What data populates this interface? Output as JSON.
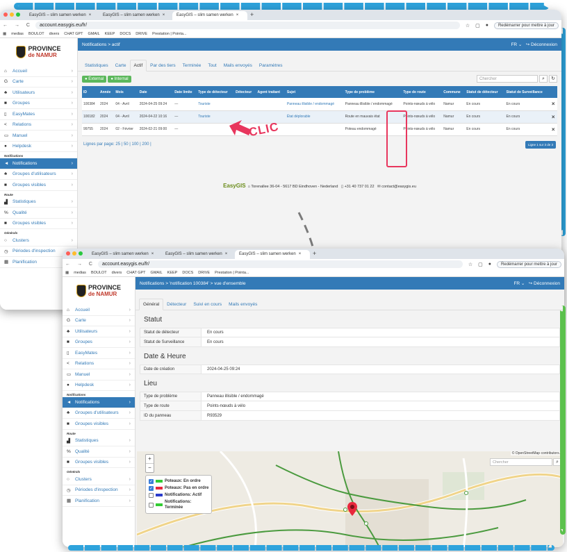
{
  "browser": {
    "tabs": [
      "EasyGIS – slim samen werken",
      "EasyGIS – slim samen werken",
      "EasyGIS – slim samen werken"
    ],
    "url": "account.easygis.eu/fr/",
    "update_label": "Redémarrer pour mettre à jour",
    "bookmarks": [
      "medias",
      "BOULOT",
      "divers",
      "CHAT GPT",
      "GMAIL",
      "KEEP",
      "DOCS",
      "DRIVE",
      "Prestation | Pointa..."
    ]
  },
  "sidebar": {
    "logo_line1": "PROVINCE",
    "logo_line2": "de NAMUR",
    "items_top": [
      {
        "label": "Accueil",
        "icon": "home-icon"
      },
      {
        "label": "Carte",
        "icon": "map-icon"
      },
      {
        "label": "Utilisateurs",
        "icon": "users-icon"
      },
      {
        "label": "Groupes",
        "icon": "folder-icon"
      },
      {
        "label": "EasyMates",
        "icon": "phone-icon"
      },
      {
        "label": "Relations",
        "icon": "share-icon"
      },
      {
        "label": "Manuel",
        "icon": "book-icon"
      },
      {
        "label": "Helpdesk",
        "icon": "question-icon"
      }
    ],
    "section_notifications": "Notifications",
    "items_notifications": [
      {
        "label": "Notifications",
        "icon": "bullhorn-icon"
      },
      {
        "label": "Groupes d'utilisateurs",
        "icon": "users-icon"
      },
      {
        "label": "Groupes visibles",
        "icon": "folder-icon"
      }
    ],
    "section_route": "Route",
    "items_route": [
      {
        "label": "Statistiques",
        "icon": "bar-chart-icon"
      },
      {
        "label": "Qualité",
        "icon": "percent-icon"
      },
      {
        "label": "Groupes visibles",
        "icon": "folder-icon"
      }
    ],
    "section_generic": "Générals",
    "items_generic": [
      {
        "label": "Clusters",
        "icon": "circle-icon"
      },
      {
        "label": "Périodes d'inspection",
        "icon": "clock-icon"
      },
      {
        "label": "Planification",
        "icon": "calendar-icon"
      }
    ]
  },
  "window1": {
    "breadcrumb": "Notifications > actif",
    "lang": "FR",
    "logout": "Déconnexion",
    "tabs": [
      "Statistiques",
      "Carte",
      "Actif",
      "Par des tiers",
      "Terminée",
      "Tout",
      "Mails envoyés",
      "Paramètres"
    ],
    "btn_external": "External",
    "btn_internal": "Internal",
    "search_placeholder": "Chercher",
    "columns": [
      "ID",
      "Année",
      "Mois",
      "Date",
      "Date limite",
      "Type de détecteur",
      "Détecteur",
      "Agent traitant",
      "Sujet",
      "Type de problème",
      "Type de route",
      "Commune",
      "Statut de détecteur",
      "Statut de Surveillance"
    ],
    "rows": [
      {
        "id": "100384",
        "year": "2024",
        "month": "04 - Avril",
        "date": "2024-04-25 09:24",
        "deadline": "—",
        "dtype": "Touriste",
        "detector": "",
        "agent": "",
        "subject": "Panneau illisible / endommagé",
        "ptype": "Panneau illisible / endommagé",
        "rtype": "Points-nœuds à vélo",
        "commune": "Namur",
        "dstatus": "En cours",
        "sstatus": "En cours"
      },
      {
        "id": "100182",
        "year": "2024",
        "month": "04 - Avril",
        "date": "2024-04-22 10:16",
        "deadline": "—",
        "dtype": "Touriste",
        "detector": "",
        "agent": "",
        "subject": "État déplorable",
        "ptype": "Route en mauvais état",
        "rtype": "Points-nœuds à vélo",
        "commune": "Namur",
        "dstatus": "En cours",
        "sstatus": "En cours"
      },
      {
        "id": "99755",
        "year": "2024",
        "month": "02 - Février",
        "date": "2024-02-21 09:00",
        "deadline": "—",
        "dtype": "",
        "detector": "",
        "agent": "",
        "subject": "",
        "ptype": "Poteau endommagé",
        "rtype": "Points-nœuds à vélo",
        "commune": "Namur",
        "dstatus": "En cours",
        "sstatus": "En cours"
      }
    ],
    "pager_label": "Lignes par page:",
    "pager_options": "25 | 50 | 100 | 200 |",
    "pager_info": "Ligne 1 sur 3 de 3",
    "footer_brand": "EasyGIS",
    "footer_address": "Torenallee 36-04 - 5617 BD Eindhoven - Nederland",
    "footer_phone": "+31 40 737 01 22",
    "footer_email": "contact@easygis.eu",
    "clic_label": "CLIC"
  },
  "window2": {
    "breadcrumb": "Notifications > 'notification 100384' > vue d'ensemble",
    "lang": "FR",
    "logout": "Déconnexion",
    "tabs": [
      "Général",
      "Détecteur",
      "Suivi en cours",
      "Mails envoyés"
    ],
    "statut_title": "Statut",
    "statut_rows": [
      {
        "k": "Statut de détecteur",
        "v": "En cours"
      },
      {
        "k": "Statut de Surveillance",
        "v": "En cours"
      }
    ],
    "date_title": "Date & Heure",
    "date_rows": [
      {
        "k": "Date de création",
        "v": "2024-04-25 09:24"
      }
    ],
    "lieu_title": "Lieu",
    "lieu_rows": [
      {
        "k": "Type de problème",
        "v": "Panneau illisible / endommagé"
      },
      {
        "k": "Type de route",
        "v": "Points-nœuds à vélo"
      },
      {
        "k": "ID du panneau",
        "v": "R93529"
      }
    ],
    "map": {
      "attribution": "© OpenStreetMap contributors.",
      "search_placeholder": "Chercher",
      "legend": [
        {
          "label": "Poteaux: En ordre",
          "color": "#33cc33",
          "checked": true
        },
        {
          "label": "Poteaux: Pas en ordre",
          "color": "#e8283c",
          "checked": true
        },
        {
          "label": "Notifications: Actif",
          "color": "#2b3ccc",
          "checked": false
        },
        {
          "label": "Notifications: Terminée",
          "color": "#33cc33",
          "checked": false
        }
      ]
    }
  },
  "colors": {
    "primary": "#337ab7",
    "green": "#5cb85c",
    "highlight": "#e8365d",
    "dash_green": "#5cc14d",
    "dash_blue": "#2ea3dc"
  }
}
